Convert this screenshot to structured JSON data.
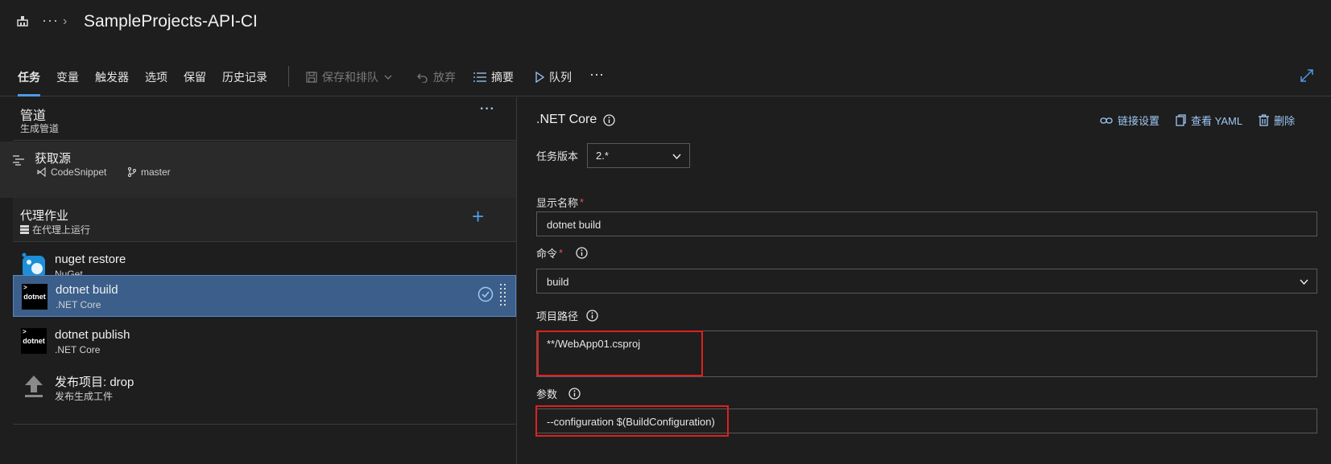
{
  "header": {
    "breadcrumb_more": "···",
    "breadcrumb_sep": "›",
    "title": "SampleProjects-API-CI"
  },
  "toolbar": {
    "tabs": [
      {
        "label": "任务",
        "active": true
      },
      {
        "label": "变量"
      },
      {
        "label": "触发器"
      },
      {
        "label": "选项"
      },
      {
        "label": "保留"
      },
      {
        "label": "历史记录"
      }
    ],
    "save_queue": "保存和排队",
    "discard": "放弃",
    "summary": "摘要",
    "queue": "队列",
    "more": "···"
  },
  "pipeline": {
    "title": "管道",
    "subtitle": "生成管道",
    "more": "···"
  },
  "source": {
    "title": "获取源",
    "repo": "CodeSnippet",
    "branch": "master"
  },
  "agent_job": {
    "title": "代理作业",
    "subtitle": "在代理上运行",
    "add": "+"
  },
  "tasks": [
    {
      "name": "nuget restore",
      "sub": "NuGet",
      "icon": "nuget-icon"
    },
    {
      "name": "dotnet build",
      "sub": ".NET Core",
      "icon": "dotnet-icon",
      "selected": true
    },
    {
      "name": "dotnet publish",
      "sub": ".NET Core",
      "icon": "dotnet-icon"
    },
    {
      "name": "发布项目: drop",
      "sub": "发布生成工件",
      "icon": "upload-icon"
    }
  ],
  "dotnet_label": "dotnet",
  "detail": {
    "title": ".NET Core",
    "link_settings": "链接设置",
    "view_yaml": "查看 YAML",
    "delete": "删除",
    "task_version_label": "任务版本",
    "task_version": "2.*",
    "display_name_label": "显示名称",
    "display_name": "dotnet build",
    "command_label": "命令",
    "command": "build",
    "project_path_label": "项目路径",
    "project_path": "**/WebApp01.csproj",
    "arguments_label": "参数",
    "arguments": "--configuration $(BuildConfiguration)",
    "required_mark": "*"
  },
  "colors": {
    "accent": "#4e9ae6",
    "selected_row": "#3b5f8a",
    "highlight": "#e02020"
  }
}
